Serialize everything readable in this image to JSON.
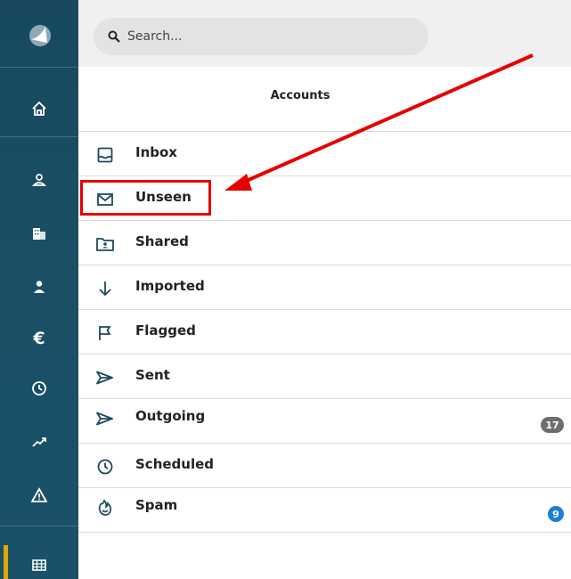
{
  "search": {
    "placeholder": "Search..."
  },
  "section": {
    "title": "Accounts"
  },
  "sidebar": {
    "icons": [
      "logo-icon",
      "home-icon",
      "contacts-icon",
      "companies-icon",
      "users-icon",
      "billing-icon",
      "time-icon",
      "reports-icon",
      "alerts-icon",
      "apps-grid-icon"
    ]
  },
  "folders": [
    {
      "label": "Inbox",
      "icon": "inbox-icon"
    },
    {
      "label": "Unseen",
      "icon": "envelope-icon"
    },
    {
      "label": "Shared",
      "icon": "shared-folder-icon"
    },
    {
      "label": "Imported",
      "icon": "arrow-down-icon"
    },
    {
      "label": "Flagged",
      "icon": "flag-icon"
    },
    {
      "label": "Sent",
      "icon": "send-icon"
    },
    {
      "label": "Outgoing",
      "icon": "send-icon",
      "badge": "17"
    },
    {
      "label": "Scheduled",
      "icon": "clock-icon"
    },
    {
      "label": "Spam",
      "icon": "spam-icon",
      "badge": "9"
    }
  ],
  "colors": {
    "rail": "#1a4f66",
    "accent": "#e6a500",
    "annotation": "#e60000",
    "badge_gray": "#6e6e6e",
    "badge_blue": "#1f7fd6"
  }
}
